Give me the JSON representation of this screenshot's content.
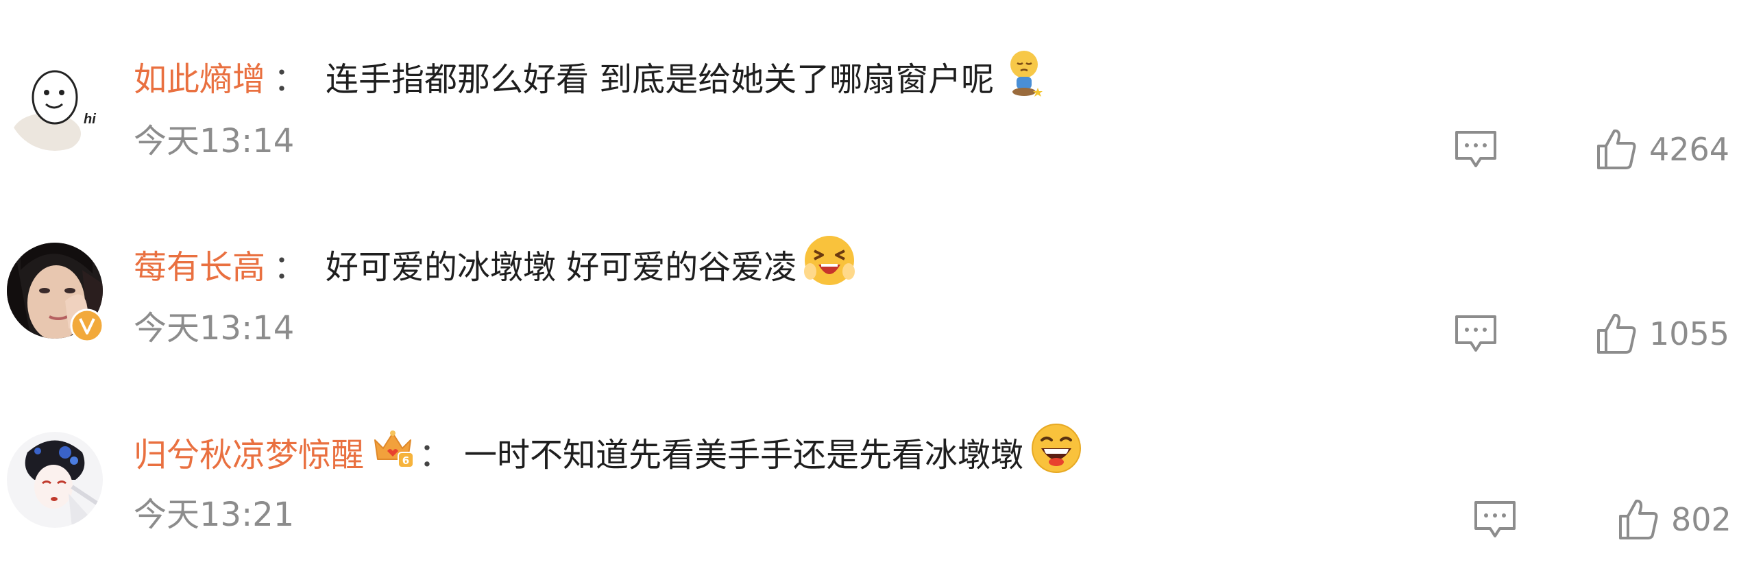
{
  "comments": [
    {
      "username": "如此熵增",
      "text": "连手指都那么好看 到底是给她关了哪扇窗户呢",
      "time": "今天13:14",
      "likes": "4264",
      "emoji": "sleepy-sitting-emoji",
      "avatar": "doodle-face-avatar"
    },
    {
      "username": "莓有长高",
      "text": "好可爱的冰墩墩 好可爱的谷爱凌",
      "time": "今天13:14",
      "likes": "1055",
      "emoji": "crying-laughing-emoji",
      "avatar": "photo-avatar",
      "verified": true
    },
    {
      "username": "归兮秋凉梦惊醒",
      "text": "一时不知道先看美手手还是先看冰墩墩",
      "time": "今天13:21",
      "likes": "802",
      "emoji": "grinning-emoji",
      "avatar": "opera-figure-avatar",
      "badge": "crown-level-6-badge"
    }
  ],
  "ui": {
    "colon": "：",
    "icons": {
      "reply": "comment-icon",
      "like": "thumbs-up-icon",
      "verified": "verified-v-badge"
    }
  },
  "colors": {
    "username": "#e97040",
    "meta": "#8c8c8c",
    "verified": "#f2a93b",
    "text": "#1e1e1e"
  }
}
